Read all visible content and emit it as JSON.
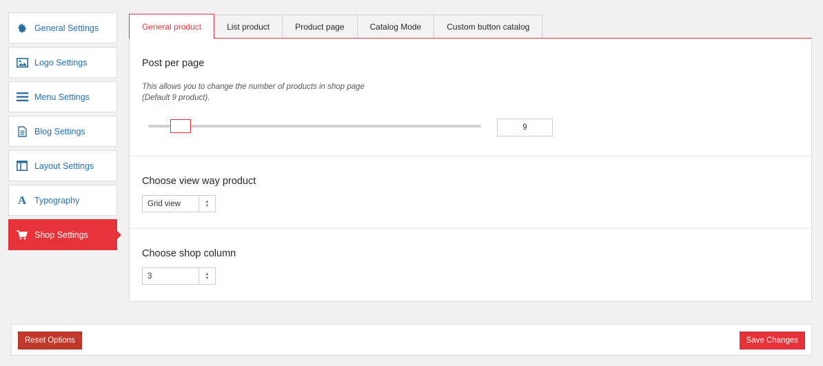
{
  "sidebar": {
    "items": [
      {
        "label": "General Settings",
        "icon": "gear-icon"
      },
      {
        "label": "Logo Settings",
        "icon": "image-icon"
      },
      {
        "label": "Menu Settings",
        "icon": "menu-icon"
      },
      {
        "label": "Blog Settings",
        "icon": "document-icon"
      },
      {
        "label": "Layout Settings",
        "icon": "layout-icon"
      },
      {
        "label": "Typography",
        "icon": "typography-icon"
      },
      {
        "label": "Shop Settings",
        "icon": "cart-icon"
      }
    ],
    "active_index": 6
  },
  "tabs": [
    {
      "label": "General product"
    },
    {
      "label": "List product"
    },
    {
      "label": "Product page"
    },
    {
      "label": "Catalog Mode"
    },
    {
      "label": "Custom button catalog"
    }
  ],
  "active_tab": 0,
  "sections": {
    "post_per_page": {
      "title": "Post per page",
      "desc_line1": "This allows you to change the number of products in shop page",
      "desc_line2": "(Default 9 product).",
      "value": "9"
    },
    "view_way": {
      "title": "Choose view way product",
      "selected": "Grid view"
    },
    "shop_column": {
      "title": "Choose shop column",
      "selected": "3"
    }
  },
  "footer": {
    "reset_label": "Reset Options",
    "save_label": "Save Changes"
  },
  "colors": {
    "accent": "#e6333a",
    "link": "#2271b1",
    "reset": "#c0392b"
  }
}
